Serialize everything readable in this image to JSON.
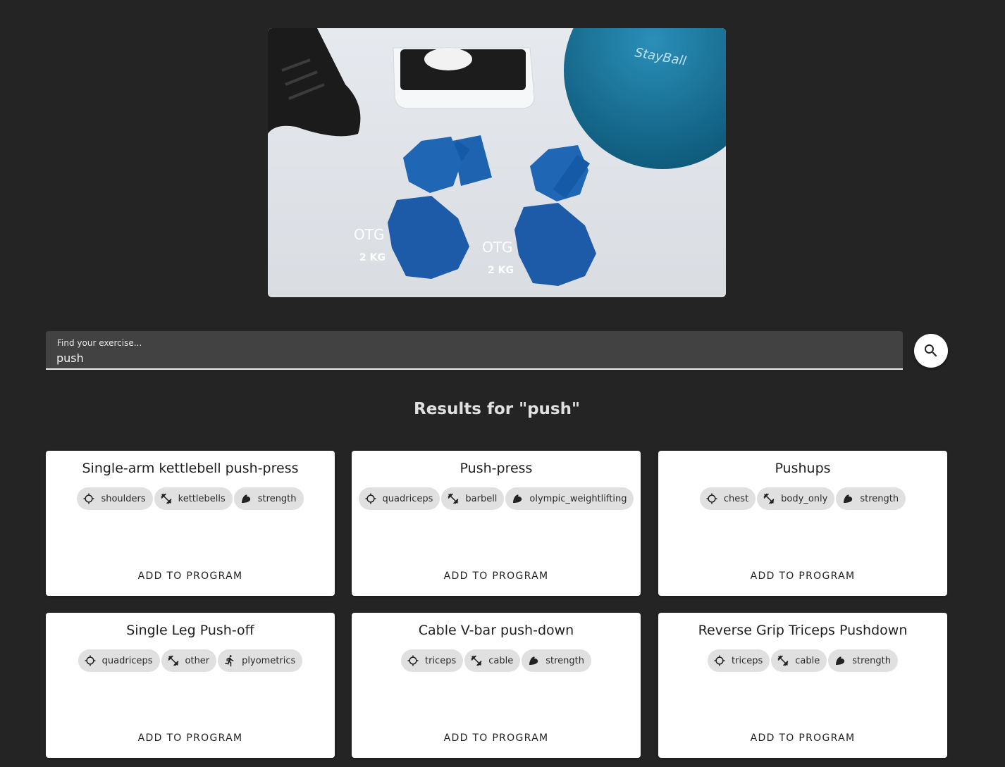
{
  "search": {
    "label": "Find your exercise...",
    "value": "push",
    "button_icon": "search-icon"
  },
  "results_heading": "Results for \"push\"",
  "cards": [
    {
      "title": "Single-arm kettlebell push-press",
      "chips": [
        {
          "icon": "target-icon",
          "label": "shoulders"
        },
        {
          "icon": "dumbbell-icon",
          "label": "kettlebells"
        },
        {
          "icon": "flexed-arm-icon",
          "label": "strength"
        }
      ],
      "button": "ADD TO PROGRAM"
    },
    {
      "title": "Push-press",
      "chips": [
        {
          "icon": "target-icon",
          "label": "quadriceps"
        },
        {
          "icon": "dumbbell-icon",
          "label": "barbell"
        },
        {
          "icon": "flexed-arm-icon",
          "label": "olympic_weightlifting"
        }
      ],
      "button": "ADD TO PROGRAM"
    },
    {
      "title": "Pushups",
      "chips": [
        {
          "icon": "target-icon",
          "label": "chest"
        },
        {
          "icon": "dumbbell-icon",
          "label": "body_only"
        },
        {
          "icon": "flexed-arm-icon",
          "label": "strength"
        }
      ],
      "button": "ADD TO PROGRAM"
    },
    {
      "title": "Single Leg Push-off",
      "chips": [
        {
          "icon": "target-icon",
          "label": "quadriceps"
        },
        {
          "icon": "dumbbell-icon",
          "label": "other"
        },
        {
          "icon": "running-icon",
          "label": "plyometrics"
        }
      ],
      "button": "ADD TO PROGRAM"
    },
    {
      "title": "Cable V-bar push-down",
      "chips": [
        {
          "icon": "target-icon",
          "label": "triceps"
        },
        {
          "icon": "dumbbell-icon",
          "label": "cable"
        },
        {
          "icon": "flexed-arm-icon",
          "label": "strength"
        }
      ],
      "button": "ADD TO PROGRAM"
    },
    {
      "title": "Reverse Grip Triceps Pushdown",
      "chips": [
        {
          "icon": "target-icon",
          "label": "triceps"
        },
        {
          "icon": "dumbbell-icon",
          "label": "cable"
        },
        {
          "icon": "flexed-arm-icon",
          "label": "strength"
        }
      ],
      "button": "ADD TO PROGRAM"
    }
  ],
  "hero_image": {
    "description_icons": [
      "dumbbell-icon",
      "scale-icon",
      "ball-icon",
      "shoe-icon"
    ],
    "dumbbell_text": "2 KG",
    "dumbbell_logo": "OTG",
    "ball_text": "StayBall"
  }
}
